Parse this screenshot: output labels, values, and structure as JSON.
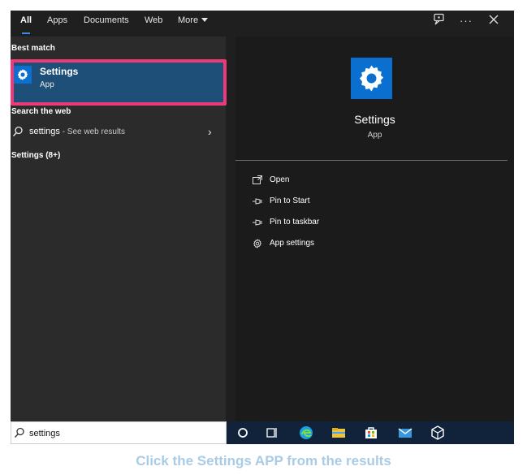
{
  "tabs": [
    {
      "label": "All",
      "active": true
    },
    {
      "label": "Apps"
    },
    {
      "label": "Documents"
    },
    {
      "label": "Web"
    },
    {
      "label": "More"
    }
  ],
  "left": {
    "best_match_heading": "Best match",
    "best_item": {
      "title": "Settings",
      "subtitle": "App",
      "icon": "gear-icon"
    },
    "web_heading": "Search the web",
    "web_item": {
      "query": "settings",
      "suffix": " - See web results"
    },
    "more_heading": "Settings (8+)"
  },
  "detail": {
    "title": "Settings",
    "subtitle": "App",
    "actions": [
      {
        "label": "Open",
        "icon": "open-icon"
      },
      {
        "label": "Pin to Start",
        "icon": "pin-icon"
      },
      {
        "label": "Pin to taskbar",
        "icon": "pin-icon"
      },
      {
        "label": "App settings",
        "icon": "gear-icon"
      }
    ]
  },
  "search": {
    "value": "settings"
  },
  "caption": "Click the Settings APP from the results",
  "colors": {
    "accent": "#0b6fcf",
    "highlight": "#ef3a78",
    "selected": "#1d4f78",
    "taskbar": "#10233a"
  }
}
